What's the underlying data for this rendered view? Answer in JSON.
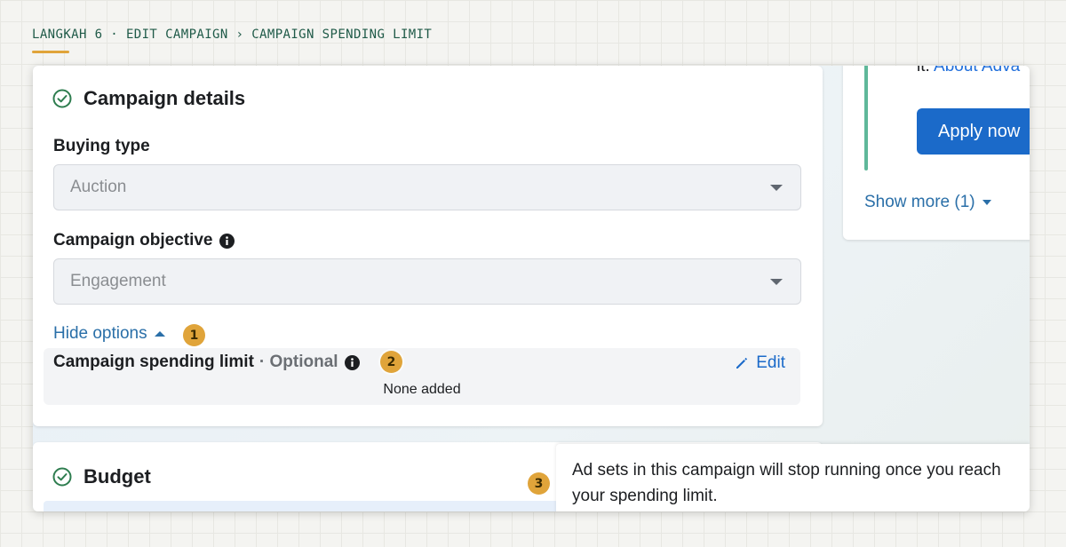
{
  "breadcrumb": "LANGKAH 6 · EDIT CAMPAIGN › CAMPAIGN SPENDING LIMIT",
  "colors": {
    "accent_yellow": "#e0a43a",
    "primary_blue": "#1b6ac9",
    "link_blue": "#2a6fa8",
    "success_green": "#2e7d4f",
    "accent_green": "#5fb89a"
  },
  "campaign_details": {
    "title": "Campaign details",
    "status_icon": "check-circle-icon",
    "buying_type": {
      "label": "Buying type",
      "value": "Auction"
    },
    "objective": {
      "label": "Campaign objective",
      "value": "Engagement",
      "icon": "info-icon"
    },
    "hide_options": "Hide options",
    "spending_limit": {
      "label": "Campaign spending limit",
      "optional": "· Optional",
      "edit": "Edit",
      "value": "None added"
    }
  },
  "budget": {
    "title": "Budget",
    "status_icon": "check-circle-icon"
  },
  "right_panel": {
    "text_prefix": "it.",
    "link": "About Adva",
    "apply_button": "Apply now",
    "show_more": "Show more (1)"
  },
  "markers": [
    "1",
    "2",
    "3"
  ],
  "tooltip": "Ad sets in this campaign will stop running once you reach your spending limit."
}
